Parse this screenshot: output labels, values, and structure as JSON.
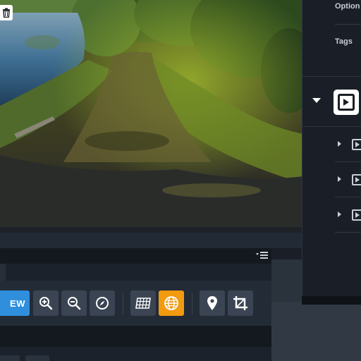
{
  "toolbar": {
    "view_label": "EW",
    "buttons": [
      {
        "name": "zoom-in",
        "icon": "zoom-in-icon"
      },
      {
        "name": "zoom-out",
        "icon": "zoom-out-icon"
      },
      {
        "name": "compass",
        "icon": "compass-icon"
      },
      {
        "name": "grid-view",
        "icon": "grid-icon"
      },
      {
        "name": "sphere-view",
        "icon": "globe-icon",
        "active": true
      },
      {
        "name": "hotspot",
        "icon": "map-pin-icon"
      },
      {
        "name": "crop",
        "icon": "crop-icon"
      }
    ]
  },
  "sidebar": {
    "options_label": "Option",
    "tags_label": "Tags",
    "group": {
      "icon": "play-media-icon",
      "expanded": true
    },
    "children": [
      {
        "icon": "play-media-icon"
      },
      {
        "icon": "play-media-icon"
      },
      {
        "icon": "play-media-icon"
      }
    ]
  },
  "colors": {
    "accent_orange": "#f29a10",
    "accent_blue": "#2f8fdd",
    "panel_dark": "#141920",
    "button_gray": "#3a4452"
  }
}
